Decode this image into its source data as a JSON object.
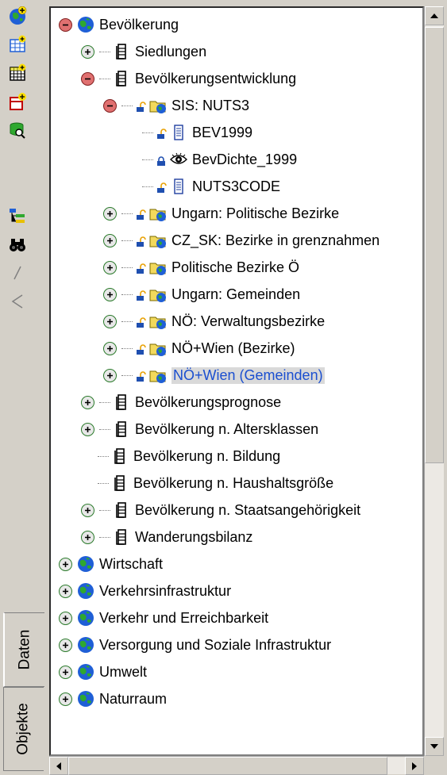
{
  "toolbar": {
    "icons": [
      "add-layer-globe-icon",
      "add-table-icon",
      "add-grid-icon",
      "add-folder-icon",
      "search-database-icon",
      "tree-view-icon",
      "binoculars-icon",
      "pencil-icon",
      "triangle-icon"
    ]
  },
  "tabs": [
    {
      "label": "Daten",
      "active": true
    },
    {
      "label": "Objekte",
      "active": false
    }
  ],
  "tree": {
    "items": [
      {
        "label": "Bevölkerung",
        "level": 0,
        "expander": "minus",
        "icon": "globe-icon"
      },
      {
        "label": "Siedlungen",
        "level": 1,
        "expander": "plus",
        "icon": "table-icon"
      },
      {
        "label": "Bevölkerungsentwicklung",
        "level": 1,
        "expander": "minus",
        "icon": "table-icon"
      },
      {
        "label": "SIS: NUTS3",
        "level": 2,
        "expander": "minus",
        "icon": "folder-globe-icon",
        "lock": "open"
      },
      {
        "label": "BEV1999",
        "level": 3,
        "expander": "none",
        "icon": "document-icon",
        "lock": "open"
      },
      {
        "label": "BevDichte_1999",
        "level": 3,
        "expander": "none",
        "icon": "eye-icon",
        "lock": "closed"
      },
      {
        "label": "NUTS3CODE",
        "level": 3,
        "expander": "none",
        "icon": "document-icon",
        "lock": "open"
      },
      {
        "label": "Ungarn: Politische Bezirke",
        "level": 2,
        "expander": "plus",
        "icon": "folder-globe-icon",
        "lock": "open"
      },
      {
        "label": "CZ_SK: Bezirke  in grenznahmen",
        "level": 2,
        "expander": "plus",
        "icon": "folder-globe-icon",
        "lock": "open"
      },
      {
        "label": "Politische Bezirke Ö",
        "level": 2,
        "expander": "plus",
        "icon": "folder-globe-icon",
        "lock": "open"
      },
      {
        "label": "Ungarn: Gemeinden",
        "level": 2,
        "expander": "plus",
        "icon": "folder-globe-icon",
        "lock": "open"
      },
      {
        "label": "NÖ: Verwaltungsbezirke",
        "level": 2,
        "expander": "plus",
        "icon": "folder-globe-icon",
        "lock": "open"
      },
      {
        "label": "NÖ+Wien (Bezirke)",
        "level": 2,
        "expander": "plus",
        "icon": "folder-globe-icon",
        "lock": "open"
      },
      {
        "label": "NÖ+Wien (Gemeinden)",
        "level": 2,
        "expander": "plus",
        "icon": "folder-globe-icon",
        "lock": "open",
        "selected": true
      },
      {
        "label": "Bevölkerungsprognose",
        "level": 1,
        "expander": "plus",
        "icon": "table-icon"
      },
      {
        "label": "Bevölkerung n. Altersklassen",
        "level": 1,
        "expander": "plus",
        "icon": "table-icon"
      },
      {
        "label": "Bevölkerung n. Bildung",
        "level": 1,
        "expander": "none",
        "icon": "table-icon"
      },
      {
        "label": "Bevölkerung n. Haushaltsgröße",
        "level": 1,
        "expander": "none",
        "icon": "table-icon"
      },
      {
        "label": "Bevölkerung n. Staatsangehörigkeit",
        "level": 1,
        "expander": "plus",
        "icon": "table-icon"
      },
      {
        "label": "Wanderungsbilanz",
        "level": 1,
        "expander": "plus",
        "icon": "table-icon"
      },
      {
        "label": "Wirtschaft",
        "level": 0,
        "expander": "plus",
        "icon": "globe-icon"
      },
      {
        "label": "Verkehrsinfrastruktur",
        "level": 0,
        "expander": "plus",
        "icon": "globe-icon"
      },
      {
        "label": "Verkehr und Erreichbarkeit",
        "level": 0,
        "expander": "plus",
        "icon": "globe-icon"
      },
      {
        "label": "Versorgung und Soziale Infrastruktur",
        "level": 0,
        "expander": "plus",
        "icon": "globe-icon"
      },
      {
        "label": "Umwelt",
        "level": 0,
        "expander": "plus",
        "icon": "globe-icon"
      },
      {
        "label": "Naturraum",
        "level": 0,
        "expander": "plus",
        "icon": "globe-icon"
      }
    ]
  },
  "colors": {
    "selected_text": "#1b4fd0",
    "globe_blue": "#1f5fd6",
    "globe_green": "#2fa82f",
    "folder_yellow": "#f2d95c"
  }
}
